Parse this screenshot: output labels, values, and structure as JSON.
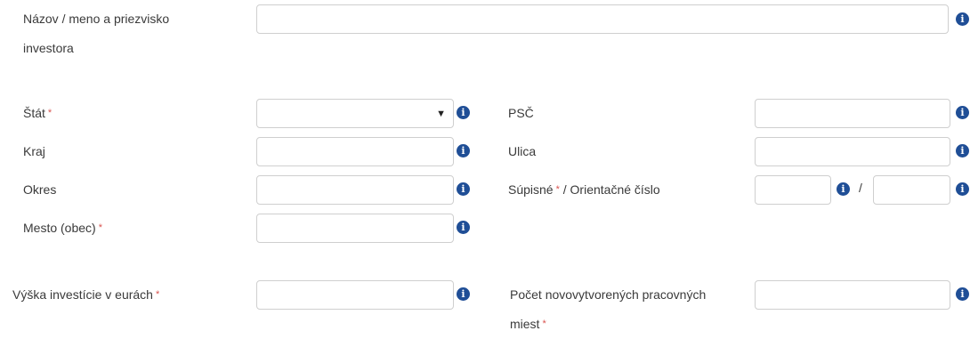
{
  "form": {
    "investor_name": {
      "label": "Názov / meno a priezvisko investora",
      "value": ""
    },
    "state": {
      "label": "Štát",
      "required_mark": "*",
      "selected": "",
      "dropdown_icon": "▼"
    },
    "region": {
      "label": "Kraj",
      "value": ""
    },
    "district": {
      "label": "Okres",
      "value": ""
    },
    "city": {
      "label": "Mesto (obec)",
      "required_mark": "*",
      "value": ""
    },
    "postal_code": {
      "label": "PSČ",
      "value": ""
    },
    "street": {
      "label": "Ulica",
      "value": ""
    },
    "house_number": {
      "label_part1": "Súpisné",
      "required_mark": "*",
      "label_part2": "/ Orientačné číslo",
      "separator": "/",
      "registry_value": "",
      "orientation_value": ""
    },
    "investment_amount": {
      "label": "Výška investície v eurách",
      "required_mark": "*",
      "value": ""
    },
    "new_jobs": {
      "label": "Počet novovytvorených pracovných miest",
      "required_mark": "*",
      "value": ""
    }
  },
  "icons": {
    "info": "info-circle-icon",
    "info_glyph": "i"
  },
  "colors": {
    "info_icon": "#1f4e96",
    "required": "#d9534f",
    "border": "#cfcfcf"
  }
}
